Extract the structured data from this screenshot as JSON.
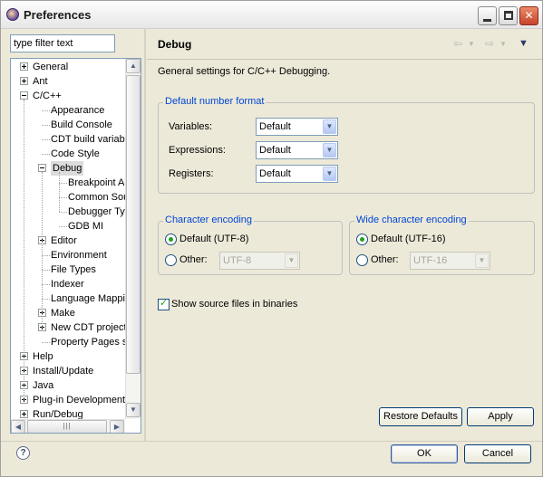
{
  "window": {
    "title": "Preferences"
  },
  "filter": {
    "placeholder": "type filter text",
    "value": "type filter text"
  },
  "tree": {
    "items": [
      {
        "label": "General",
        "level": 0,
        "expander": "plus"
      },
      {
        "label": "Ant",
        "level": 0,
        "expander": "plus"
      },
      {
        "label": "C/C++",
        "level": 0,
        "expander": "minus"
      },
      {
        "label": "Appearance",
        "level": 1,
        "expander": "none"
      },
      {
        "label": "Build Console",
        "level": 1,
        "expander": "none"
      },
      {
        "label": "CDT build variable",
        "level": 1,
        "expander": "none"
      },
      {
        "label": "Code Style",
        "level": 1,
        "expander": "none"
      },
      {
        "label": "Debug",
        "level": 1,
        "expander": "minus",
        "selected": true
      },
      {
        "label": "Breakpoint Ac",
        "level": 2,
        "expander": "none"
      },
      {
        "label": "Common Sour",
        "level": 2,
        "expander": "none"
      },
      {
        "label": "Debugger Typ",
        "level": 2,
        "expander": "none"
      },
      {
        "label": "GDB MI",
        "level": 2,
        "expander": "none"
      },
      {
        "label": "Editor",
        "level": 1,
        "expander": "plus"
      },
      {
        "label": "Environment",
        "level": 1,
        "expander": "none"
      },
      {
        "label": "File Types",
        "level": 1,
        "expander": "none"
      },
      {
        "label": "Indexer",
        "level": 1,
        "expander": "none"
      },
      {
        "label": "Language Mappin",
        "level": 1,
        "expander": "none"
      },
      {
        "label": "Make",
        "level": 1,
        "expander": "plus"
      },
      {
        "label": "New CDT project",
        "level": 1,
        "expander": "plus"
      },
      {
        "label": "Property Pages s",
        "level": 1,
        "expander": "none"
      },
      {
        "label": "Help",
        "level": 0,
        "expander": "plus"
      },
      {
        "label": "Install/Update",
        "level": 0,
        "expander": "plus"
      },
      {
        "label": "Java",
        "level": 0,
        "expander": "plus"
      },
      {
        "label": "Plug-in Development",
        "level": 0,
        "expander": "plus"
      },
      {
        "label": "Run/Debug",
        "level": 0,
        "expander": "plus"
      }
    ]
  },
  "page": {
    "title": "Debug",
    "description": "General settings for C/C++ Debugging.",
    "number_format": {
      "title": "Default number format",
      "fields": [
        {
          "label": "Variables:",
          "value": "Default"
        },
        {
          "label": "Expressions:",
          "value": "Default"
        },
        {
          "label": "Registers:",
          "value": "Default"
        }
      ]
    },
    "char_encoding": {
      "title": "Character encoding",
      "default_option": "Default (UTF-8)",
      "other_option": "Other:",
      "other_value": "UTF-8",
      "selected": "default"
    },
    "wide_encoding": {
      "title": "Wide character encoding",
      "default_option": "Default (UTF-16)",
      "other_option": "Other:",
      "other_value": "UTF-16",
      "selected": "default"
    },
    "show_source": {
      "label": "Show source files in binaries",
      "checked": true
    },
    "restore_defaults": "Restore Defaults",
    "apply": "Apply"
  },
  "footer": {
    "ok": "OK",
    "cancel": "Cancel"
  },
  "colors": {
    "group_title": "#0046d5",
    "check_green": "#21a121"
  }
}
